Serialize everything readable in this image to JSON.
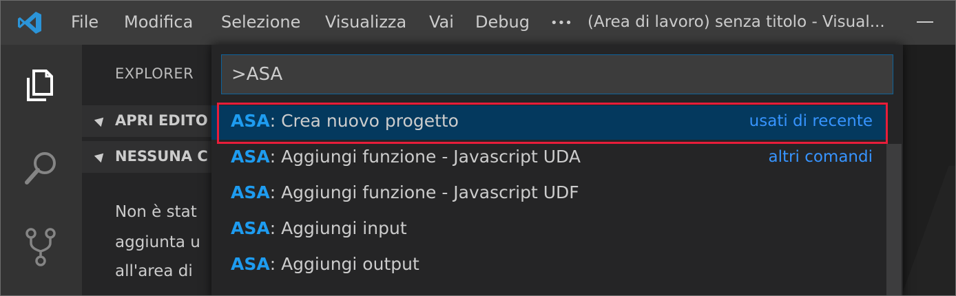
{
  "titlebar": {
    "menu": [
      "File",
      "Modifica",
      "Selezione",
      "Visualizza",
      "Vai",
      "Debug",
      "•••"
    ],
    "title": "(Area di lavoro) senza titolo - Visual..."
  },
  "activitybar": {
    "icons": [
      "files-icon",
      "search-icon",
      "source-control-icon"
    ]
  },
  "sidebar": {
    "title": "EXPLORER",
    "sections": [
      "APRI EDITO",
      "NESSUNA C"
    ],
    "empty_lines": [
      "Non è stat",
      "aggiunta u",
      "all'area di"
    ]
  },
  "quickpick": {
    "input_value": ">ASA",
    "items": [
      {
        "prefix": "ASA",
        "label": ": Crea nuovo progetto",
        "desc": "usati di recente",
        "selected": true
      },
      {
        "prefix": "ASA",
        "label": ": Aggiungi funzione - Javascript UDA",
        "desc": "altri comandi",
        "selected": false
      },
      {
        "prefix": "ASA",
        "label": ": Aggiungi funzione - Javascript UDF",
        "desc": "",
        "selected": false
      },
      {
        "prefix": "ASA",
        "label": ": Aggiungi input",
        "desc": "",
        "selected": false
      },
      {
        "prefix": "ASA",
        "label": ": Aggiungi output",
        "desc": "",
        "selected": false
      }
    ]
  },
  "colors": {
    "accent": "#007acc",
    "highlight": "#1e9cf0",
    "description": "#3794ff",
    "annotation": "#e81d3a"
  }
}
